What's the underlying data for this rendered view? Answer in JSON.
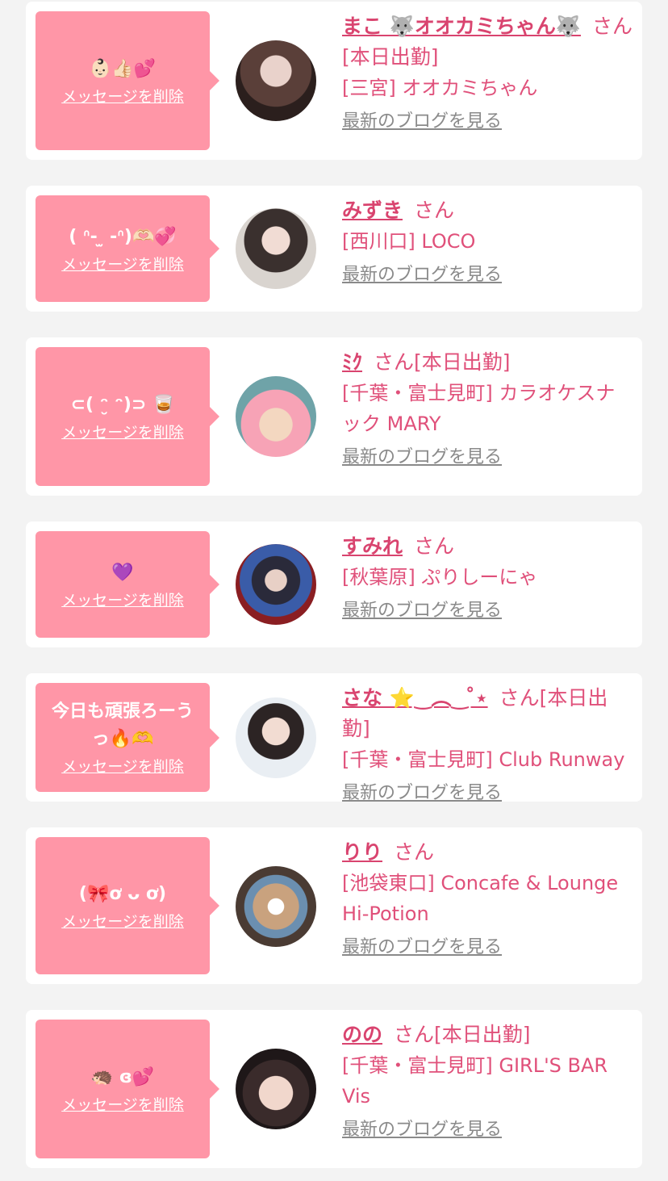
{
  "delete_label": "メッセージを削除",
  "honorific": "さん",
  "blog_link": "最新のブログを見る",
  "accent_color": "#ff96a7",
  "cards": [
    {
      "message": "👶🏻👍🏻💕",
      "name": "まこ 🐺オオカミちゃん🐺",
      "status": "[本日出勤]",
      "shop": "[三宮] オオカミちゃん"
    },
    {
      "message": "( ᐢ- ̫ -ᐢ)🫶🏻💞",
      "name": "みずき",
      "status": "",
      "shop": "[西川口] LOCO"
    },
    {
      "message": "⊂( ᵔ̮ ᵔ)⊃ 🥃",
      "name": "ﾐｸ",
      "status": "[本日出勤]",
      "shop": "[千葉・富士見町] カラオケスナック MARY"
    },
    {
      "message": "💜",
      "name": "すみれ",
      "status": "",
      "shop": "[秋葉原] ぷりしーにゃ"
    },
    {
      "message": "今日も頑張ろーうっ🔥🫶",
      "name": "さな ⭐️‿︵‿ ̊⋆",
      "status": "[本日出勤]",
      "shop": "[千葉・富士見町] Club Runway"
    },
    {
      "message": "(🎀ơ ᴗ ơ)",
      "name": "りり",
      "status": "",
      "shop": "[池袋東口] Concafe & Lounge Hi-Potion"
    },
    {
      "message": "🦔 ɞ💕",
      "name": "のの",
      "status": "[本日出勤]",
      "shop": "[千葉・富士見町] GIRL'S BAR Vis"
    }
  ]
}
